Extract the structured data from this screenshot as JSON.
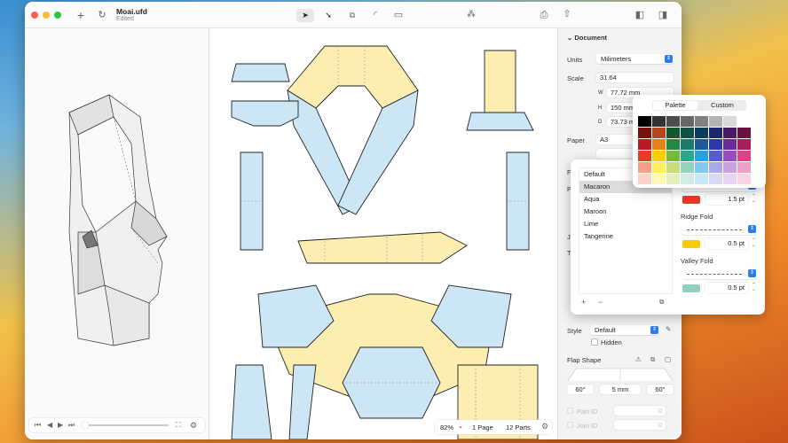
{
  "window": {
    "title": "Moai.ufd",
    "subtitle": "Edited"
  },
  "toolbar": {
    "icons": [
      "new-icon",
      "refresh-icon",
      "select-arrow-icon",
      "direct-select-icon",
      "parts-icon",
      "curve-icon",
      "ruler-icon",
      "magic-wand-icon",
      "print-icon",
      "share-icon",
      "left-sidebar-icon",
      "right-sidebar-icon"
    ]
  },
  "document": {
    "section": "Document",
    "units_label": "Units",
    "units_value": "Milimeters",
    "scale_label": "Scale",
    "scale_value": "31.64",
    "w_label": "W",
    "w_value": "77.72 mm",
    "h_label": "H",
    "h_value": "150 mm",
    "d_label": "D",
    "d_value": "73.73 mm",
    "paper_label": "Paper",
    "paper_value": "A3",
    "hidden_labels": [
      "Fl",
      "Pa",
      "Je",
      "Te"
    ]
  },
  "palette_popover": {
    "tabs": [
      "Palette",
      "Custom"
    ],
    "selected_tab": "Palette",
    "colors": [
      "#000000",
      "#333333",
      "#4d4d4d",
      "#666666",
      "#808080",
      "#b3b3b3",
      "#d9d9d9",
      "#ffffff",
      "#7a0f0f",
      "#b5471b",
      "#0f5a2e",
      "#0f5245",
      "#0e3a5e",
      "#1d2670",
      "#4a1a66",
      "#6b1040",
      "#b41e1e",
      "#e6821e",
      "#1e8c3c",
      "#1e7a6a",
      "#1e5a9a",
      "#2a3aa8",
      "#6a2a9a",
      "#a81e5a",
      "#e83a28",
      "#ffcc00",
      "#78b83c",
      "#28a890",
      "#28a0e0",
      "#5a5ad0",
      "#9a4ac0",
      "#e0408a",
      "#f4a088",
      "#fff060",
      "#c8dc78",
      "#90d4c0",
      "#80c8f0",
      "#a8a8e8",
      "#c8a0e0",
      "#f0a0c8",
      "#fbd4c8",
      "#fff8b8",
      "#e4eec0",
      "#d0ece4",
      "#c8e8f8",
      "#d8d8f4",
      "#e8d4f0",
      "#f8d4e4"
    ]
  },
  "style_popover": {
    "styles": [
      "Default",
      "Macaron",
      "Aqua",
      "Maroon",
      "Lime",
      "Tangerine"
    ],
    "selected": "Macaron",
    "cut_color": "#e63a26",
    "cut_width": "1.5 pt",
    "ridge_label": "Ridge Fold",
    "ridge_color": "#f8cc00",
    "ridge_width": "0.5 pt",
    "valley_label": "Valley Fold",
    "valley_color": "#8fd0c0",
    "valley_width": "0.5 pt",
    "add": "+",
    "remove": "−"
  },
  "style_row": {
    "label": "Style",
    "value": "Default",
    "hidden_label": "Hidden"
  },
  "flap": {
    "label": "Flap Shape",
    "left_angle": "60°",
    "length": "5 mm",
    "right_angle": "60°"
  },
  "ids": {
    "part_label": "Part ID",
    "part_value": "0",
    "join_label": "Join ID",
    "join_value": "0"
  },
  "status": {
    "zoom": "82%",
    "pages": "1 Page",
    "parts": "12 Parts"
  },
  "colors": {
    "blue_fill": "#cde6f5",
    "yellow_fill": "#fbeeb0",
    "accent": "#2a7cf0"
  }
}
